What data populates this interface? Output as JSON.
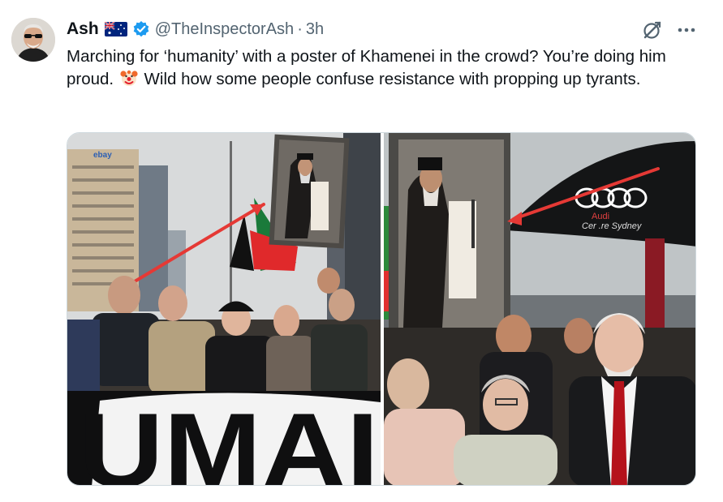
{
  "tweet": {
    "author_name": "Ash",
    "handle": "@TheInspectorAsh",
    "separator": "·",
    "time": "3h",
    "text_part1": "Marching for ‘humanity’ with a poster of Khamenei in the crowd? You’re doing him proud.",
    "text_part2": "Wild how some people confuse resistance with propping up tyrants.",
    "emoji": "clown-face-emoji"
  },
  "icons": {
    "flag": "australia-flag-icon",
    "verified": "verified-badge-icon",
    "grok": "grok-icon",
    "more": "more-options-icon"
  },
  "media": {
    "left_photo_banner": "UMAI",
    "right_photo_umbrella_logo": "Audi",
    "right_photo_umbrella_text": "Cer .re Sydney",
    "left_photo_billboard": "ebay"
  },
  "colors": {
    "text": "#0f1419",
    "secondary": "#536471",
    "verified": "#1d9bf0",
    "arrow": "#e53935"
  }
}
